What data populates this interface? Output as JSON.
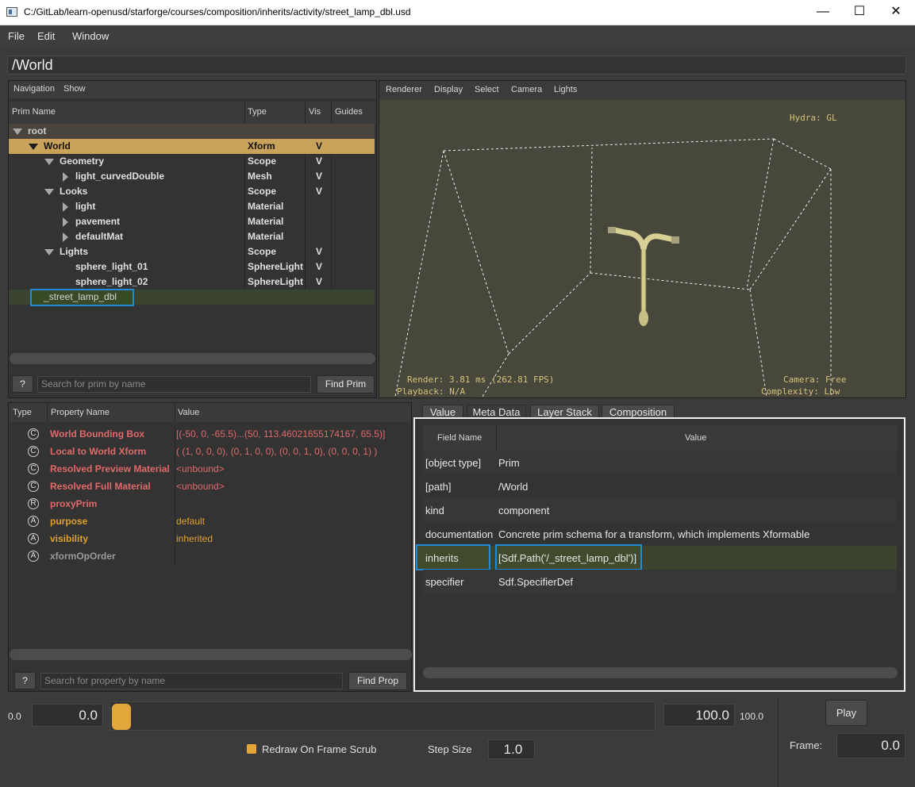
{
  "window": {
    "title": "C:/GitLab/learn-openusd/starforge/courses/composition/inherits/activity/street_lamp_dbl.usd",
    "minimize": "—",
    "maximize": "☐",
    "close": "✕"
  },
  "menu": [
    "File",
    "Edit",
    "Window"
  ],
  "path": "/World",
  "prim_panel": {
    "menu": [
      "Navigation",
      "Show"
    ],
    "headers": [
      "Prim Name",
      "Type",
      "Vis",
      "Guides"
    ],
    "rows": [
      {
        "name": "root",
        "type": "",
        "vis": ""
      },
      {
        "name": "World",
        "type": "Xform",
        "vis": "V"
      },
      {
        "name": "Geometry",
        "type": "Scope",
        "vis": "V"
      },
      {
        "name": "light_curvedDouble",
        "type": "Mesh",
        "vis": "V"
      },
      {
        "name": "Looks",
        "type": "Scope",
        "vis": "V"
      },
      {
        "name": "light",
        "type": "Material",
        "vis": ""
      },
      {
        "name": "pavement",
        "type": "Material",
        "vis": ""
      },
      {
        "name": "defaultMat",
        "type": "Material",
        "vis": ""
      },
      {
        "name": "Lights",
        "type": "Scope",
        "vis": "V"
      },
      {
        "name": "sphere_light_01",
        "type": "SphereLight",
        "vis": "V"
      },
      {
        "name": "sphere_light_02",
        "type": "SphereLight",
        "vis": "V"
      },
      {
        "name": "_street_lamp_dbl",
        "type": "",
        "vis": ""
      }
    ],
    "help": "?",
    "search_placeholder": "Search for prim by name",
    "find": "Find Prim"
  },
  "viewport": {
    "menu": [
      "Renderer",
      "Display",
      "Select",
      "Camera",
      "Lights"
    ],
    "hydra": "Hydra: GL",
    "render": "Render: 3.81 ms (262.81 FPS)",
    "playback": "Playback: N/A",
    "camera": "Camera: Free",
    "complexity": "Complexity: Low"
  },
  "property_panel": {
    "headers": [
      "Type",
      "Property Name",
      "Value"
    ],
    "rows": [
      {
        "type": "C",
        "name": "World Bounding Box",
        "value": "[(-50, 0, -65.5)...(50, 113.46021655174167, 65.5)]",
        "color": "#e06a6a"
      },
      {
        "type": "C",
        "name": "Local to World Xform",
        "value": "( (1, 0, 0, 0), (0, 1, 0, 0), (0, 0, 1, 0), (0, 0, 0, 1) )",
        "color": "#e06a6a"
      },
      {
        "type": "C",
        "name": "Resolved Preview Material",
        "value": "<unbound>",
        "color": "#e06a6a"
      },
      {
        "type": "C",
        "name": "Resolved Full Material",
        "value": "<unbound>",
        "color": "#e06a6a"
      },
      {
        "type": "R",
        "name": "proxyPrim",
        "value": "",
        "color": "#e06a6a"
      },
      {
        "type": "A",
        "name": "purpose",
        "value": "default",
        "color": "#e0a030"
      },
      {
        "type": "A",
        "name": "visibility",
        "value": "inherited",
        "color": "#e0a030"
      },
      {
        "type": "A",
        "name": "xformOpOrder",
        "value": "",
        "color": "#9a9a9a"
      }
    ],
    "help": "?",
    "search_placeholder": "Search for property by name",
    "find": "Find Prop"
  },
  "meta_panel": {
    "tabs": [
      "Value",
      "Meta Data",
      "Layer Stack",
      "Composition"
    ],
    "headers": [
      "Field Name",
      "Value"
    ],
    "rows": [
      {
        "field": "[object type]",
        "value": "Prim"
      },
      {
        "field": "[path]",
        "value": "/World"
      },
      {
        "field": "kind",
        "value": "component"
      },
      {
        "field": "documentation",
        "value": "Concrete prim schema for a transform, which implements Xformable"
      },
      {
        "field": "inherits",
        "value": "[Sdf.Path('/_street_lamp_dbl')]"
      },
      {
        "field": "specifier",
        "value": "Sdf.SpecifierDef"
      }
    ]
  },
  "timeline": {
    "start_label": "0.0",
    "start_value": "0.0",
    "end_value": "100.0",
    "end_label": "100.0",
    "redraw": "Redraw On Frame Scrub",
    "step_label": "Step Size",
    "step_value": "1.0",
    "play": "Play",
    "frame_label": "Frame:",
    "frame_value": "0.0",
    "slider_position": 0
  }
}
